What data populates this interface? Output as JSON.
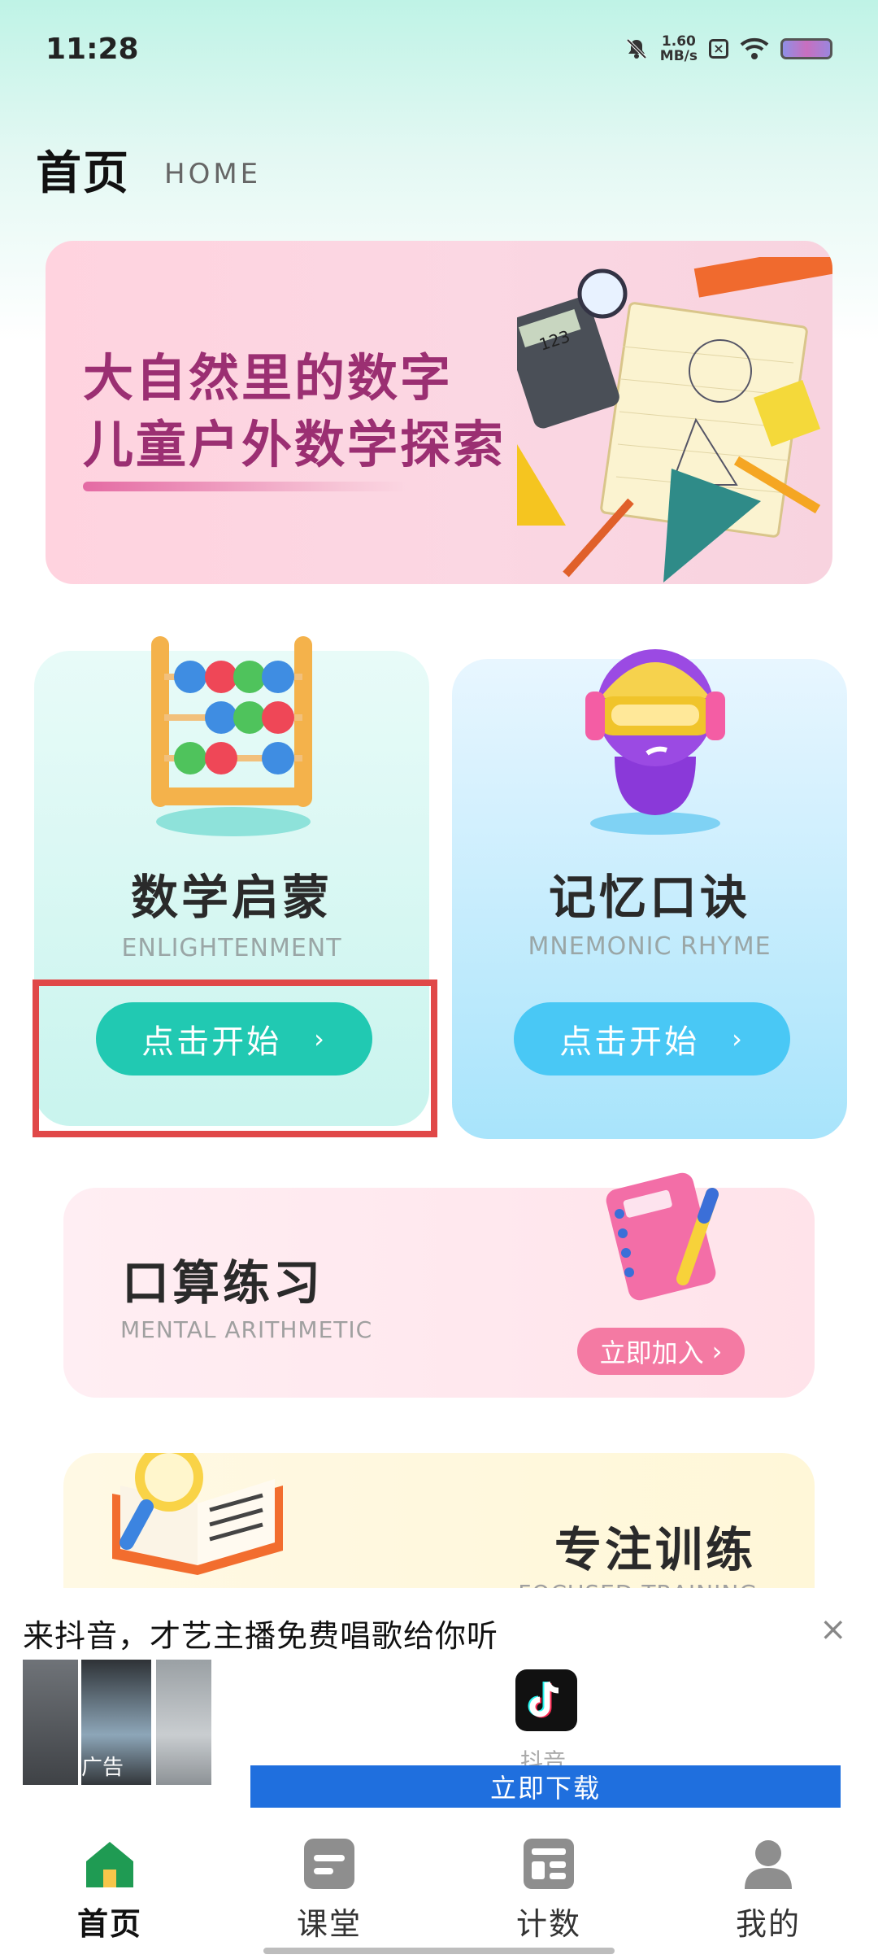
{
  "status_bar": {
    "time": "11:28",
    "speed_value": "1.60",
    "speed_unit": "MB/s"
  },
  "header": {
    "title": "首页",
    "subtitle": "HOME"
  },
  "banner": {
    "line1": "大自然里的数字",
    "line2": "儿童户外数学探索",
    "calculator_display": "123"
  },
  "cards": {
    "math": {
      "title": "数学启蒙",
      "subtitle": "ENLIGHTENMENT",
      "button": "点击开始",
      "button_chevron": "›"
    },
    "memory": {
      "title": "记忆口诀",
      "subtitle": "MNEMONIC RHYME",
      "button": "点击开始",
      "button_chevron": "›"
    },
    "arithmetic": {
      "title": "口算练习",
      "subtitle": "MENTAL ARITHMETIC",
      "button": "立即加入",
      "button_chevron": "›"
    },
    "focus": {
      "title": "专注训练",
      "subtitle": "FOCUSED TRAINING"
    }
  },
  "ad": {
    "title": "来抖音，才艺主播免费唱歌给你听",
    "tag": "广告",
    "app_name": "抖音",
    "download": "立即下载",
    "close": "×"
  },
  "nav": {
    "items": [
      {
        "label": "首页",
        "icon": "home-icon",
        "active": true
      },
      {
        "label": "课堂",
        "icon": "classroom-icon",
        "active": false
      },
      {
        "label": "计数",
        "icon": "count-icon",
        "active": false
      },
      {
        "label": "我的",
        "icon": "profile-icon",
        "active": false
      }
    ]
  },
  "colors": {
    "accent_green": "#21c9b2",
    "accent_blue": "#49c8f5",
    "highlight_red": "#e04848",
    "nav_active": "#1f9b53"
  }
}
